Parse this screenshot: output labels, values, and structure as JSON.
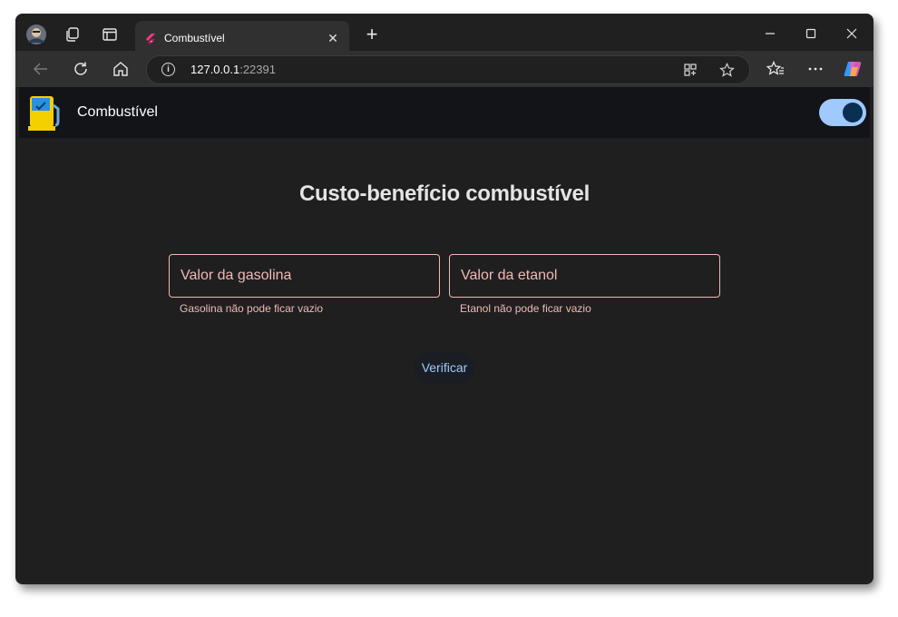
{
  "browser": {
    "tab": {
      "title": "Combustível"
    },
    "address": {
      "host": "127.0.0.1",
      "port": ":22391"
    }
  },
  "app": {
    "title": "Combustível",
    "theme": {
      "dark_mode": true,
      "toggle_color": "#9fc9ff"
    }
  },
  "main": {
    "heading": "Custo-benefício combustível",
    "gasolina": {
      "label": "Valor da gasolina",
      "error": "Gasolina não pode ficar vazio"
    },
    "etanol": {
      "label": "Valor da etanol",
      "error": "Etanol não pode ficar vazio"
    },
    "verify_label": "Verificar"
  },
  "colors": {
    "error": "#f2b8b5",
    "accent": "#9fc9ff",
    "appbar": "#121418",
    "page_bg": "#1f1f1f"
  },
  "icons": [
    "profile-avatar-icon",
    "workspaces-icon",
    "tab-actions-icon",
    "flutter-favicon-icon",
    "close-icon",
    "plus-icon",
    "minimize-icon",
    "maximize-icon",
    "close-window-icon",
    "back-icon",
    "refresh-icon",
    "home-icon",
    "site-info-icon",
    "app-available-icon",
    "favorite-star-icon",
    "favorites-icon",
    "more-icon",
    "copilot-icon",
    "fuel-pump-icon",
    "moon-icon"
  ]
}
